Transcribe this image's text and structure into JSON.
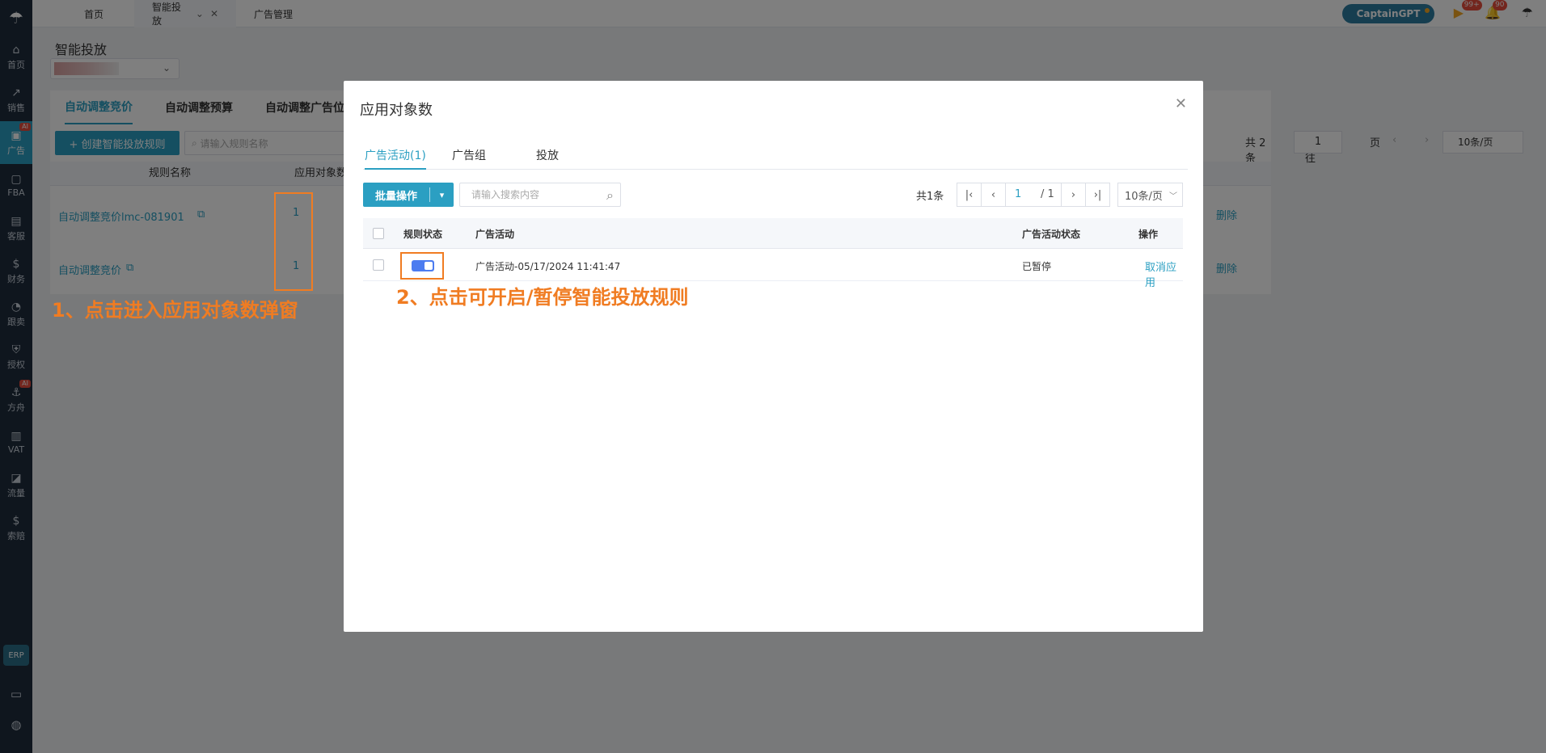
{
  "sidebar": {
    "items": [
      {
        "label": "首页",
        "icon": "home-icon",
        "glyph": "⌂",
        "ai": ""
      },
      {
        "label": "销售",
        "icon": "chart-icon",
        "glyph": "↗",
        "ai": ""
      },
      {
        "label": "广告",
        "icon": "ad-icon",
        "glyph": "▣",
        "ai": "AI"
      },
      {
        "label": "FBA",
        "icon": "box-icon",
        "glyph": "▢",
        "ai": ""
      },
      {
        "label": "客服",
        "icon": "service-icon",
        "glyph": "▤",
        "ai": ""
      },
      {
        "label": "财务",
        "icon": "money-icon",
        "glyph": "$",
        "ai": ""
      },
      {
        "label": "跟卖",
        "icon": "pie-icon",
        "glyph": "◔",
        "ai": ""
      },
      {
        "label": "授权",
        "icon": "shield-icon",
        "glyph": "⛨",
        "ai": ""
      },
      {
        "label": "方舟",
        "icon": "ark-icon",
        "glyph": "⚓",
        "ai": "AI"
      },
      {
        "label": "VAT",
        "icon": "building-icon",
        "glyph": "▥",
        "ai": ""
      },
      {
        "label": "流量",
        "icon": "traffic-icon",
        "glyph": "◪",
        "ai": ""
      },
      {
        "label": "索赔",
        "icon": "claim-icon",
        "glyph": "$",
        "ai": ""
      }
    ],
    "erp": "ERP"
  },
  "topbar": {
    "tabs": [
      "首页",
      "智能投放",
      "广告管理"
    ],
    "close_glyph": "✕",
    "captain": "CaptainGPT",
    "badge_play": "99+",
    "badge_bell": "90"
  },
  "page": {
    "title": "智能投放",
    "rule_tabs": [
      "自动调整竞价",
      "自动调整预算",
      "自动调整广告位"
    ],
    "create_btn": "+ 创建智能投放规则",
    "search_placeholder": "请输入规则名称",
    "total": "共 2 条",
    "goto": "前往",
    "page_num": "1",
    "page_unit": "页",
    "page_size": "10条/页",
    "columns": [
      "规则名称",
      "应用对象数"
    ],
    "rows": [
      {
        "name": "自动调整竞价lmc-081901",
        "count": "1",
        "action": "删除"
      },
      {
        "name": "自动调整竞价",
        "count": "1",
        "action": "删除"
      }
    ]
  },
  "annotations": {
    "a1": "1、点击进入应用对象数弹窗",
    "a2": "2、点击可开启/暂停智能投放规则"
  },
  "modal": {
    "title": "应用对象数",
    "tabs": [
      "广告活动(1)",
      "广告组",
      "投放"
    ],
    "batch_btn": "批量操作",
    "search_placeholder": "请输入搜索内容",
    "total": "共1条",
    "page_current": "1",
    "page_total": "/ 1",
    "page_size": "10条/页",
    "columns": {
      "status": "规则状态",
      "campaign": "广告活动",
      "campaign_status": "广告活动状态",
      "action": "操作"
    },
    "rows": [
      {
        "campaign": "广告活动-05/17/2024 11:41:47",
        "campaign_status": "已暂停",
        "action": "取消应用",
        "enabled": true
      }
    ]
  },
  "colors": {
    "accent": "#2b9fc2",
    "annotation": "#f07c22",
    "switch_on": "#4c7cf0"
  }
}
